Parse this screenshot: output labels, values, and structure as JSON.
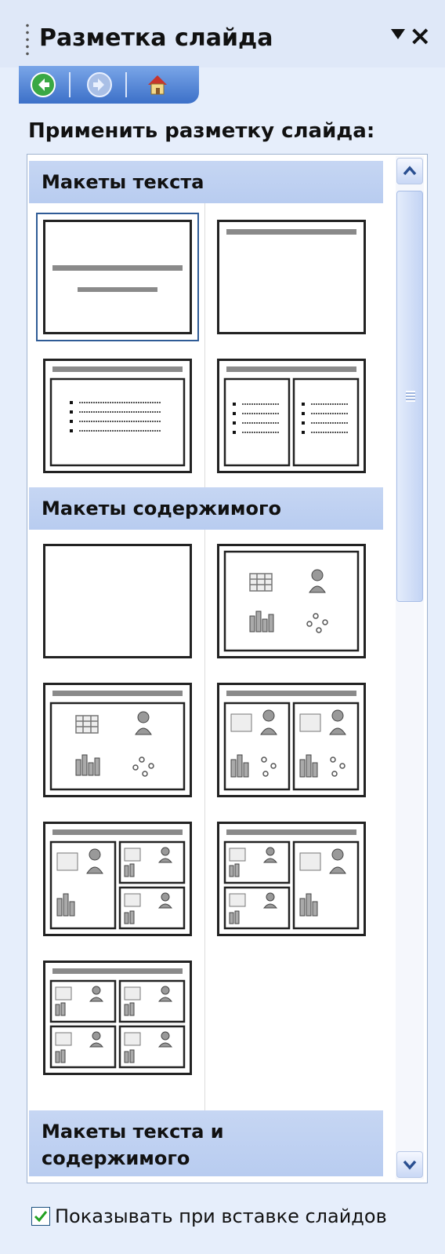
{
  "pane": {
    "title": "Разметка слайда",
    "apply_heading": "Применить разметку слайда:"
  },
  "sections": {
    "text_layouts": "Макеты текста",
    "content_layouts": "Макеты содержимого",
    "text_and_content_line1": "Макеты текста и",
    "text_and_content_line2": "содержимого"
  },
  "footer": {
    "show_on_insert_label": "Показывать при вставке слайдов",
    "show_on_insert_checked": true
  },
  "icons": {
    "back": "back-arrow-icon",
    "forward": "forward-arrow-icon",
    "home": "home-icon",
    "dropdown": "triangle-down",
    "close": "x"
  },
  "colors": {
    "pane_bg": "#e6eefb",
    "section_header": "#bfd1f1",
    "nav_strip": "#3c70c8",
    "selection_border": "#2f5b96"
  }
}
